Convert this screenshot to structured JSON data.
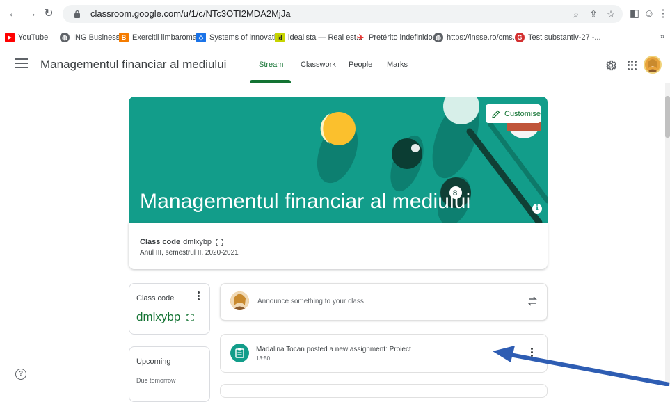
{
  "browser": {
    "url": "classroom.google.com/u/1/c/NTc3OTI2MDA2MjJa",
    "bookmarks": [
      {
        "label": "YouTube",
        "color": "#ff0000",
        "glyph": "▶"
      },
      {
        "label": "ING Business",
        "color": "#5f6368",
        "glyph": "◍"
      },
      {
        "label": "Exercitii limbaroma...",
        "color": "#f57c00",
        "glyph": "B"
      },
      {
        "label": "Systems of innovati...",
        "color": "#1a73e8",
        "glyph": "◇"
      },
      {
        "label": "idealista — Real est...",
        "color": "#c6d400",
        "glyph": "id"
      },
      {
        "label": "Pretérito indefinido...",
        "color": "#e53935",
        "glyph": "✈"
      },
      {
        "label": "https://insse.ro/cms...",
        "color": "#5f6368",
        "glyph": "◍"
      },
      {
        "label": "Test substantiv-27 -...",
        "color": "#d32f2f",
        "glyph": "G"
      }
    ],
    "more": "»"
  },
  "header": {
    "class_title": "Managementul financiar al mediului",
    "tabs": [
      {
        "label": "Stream",
        "active": true
      },
      {
        "label": "Classwork",
        "active": false
      },
      {
        "label": "People",
        "active": false
      },
      {
        "label": "Marks",
        "active": false
      }
    ]
  },
  "banner": {
    "title": "Managementul financiar al mediului",
    "customise_label": "Customise",
    "info_glyph": "i",
    "class_code_label": "Class code",
    "class_code": "dmlxybp",
    "section": "Anul III, semestrul II, 2020-2021",
    "accent": "#129d8a"
  },
  "sidebar": {
    "code_card_label": "Class code",
    "code_card_value": "dmlxybp",
    "upcoming_title": "Upcoming",
    "upcoming_due": "Due tomorrow"
  },
  "stream": {
    "announce_placeholder": "Announce something to your class",
    "post_title": "Madalina Tocan posted a new assignment: Proiect",
    "post_time": "13:50"
  },
  "misc": {
    "help_glyph": "?"
  }
}
